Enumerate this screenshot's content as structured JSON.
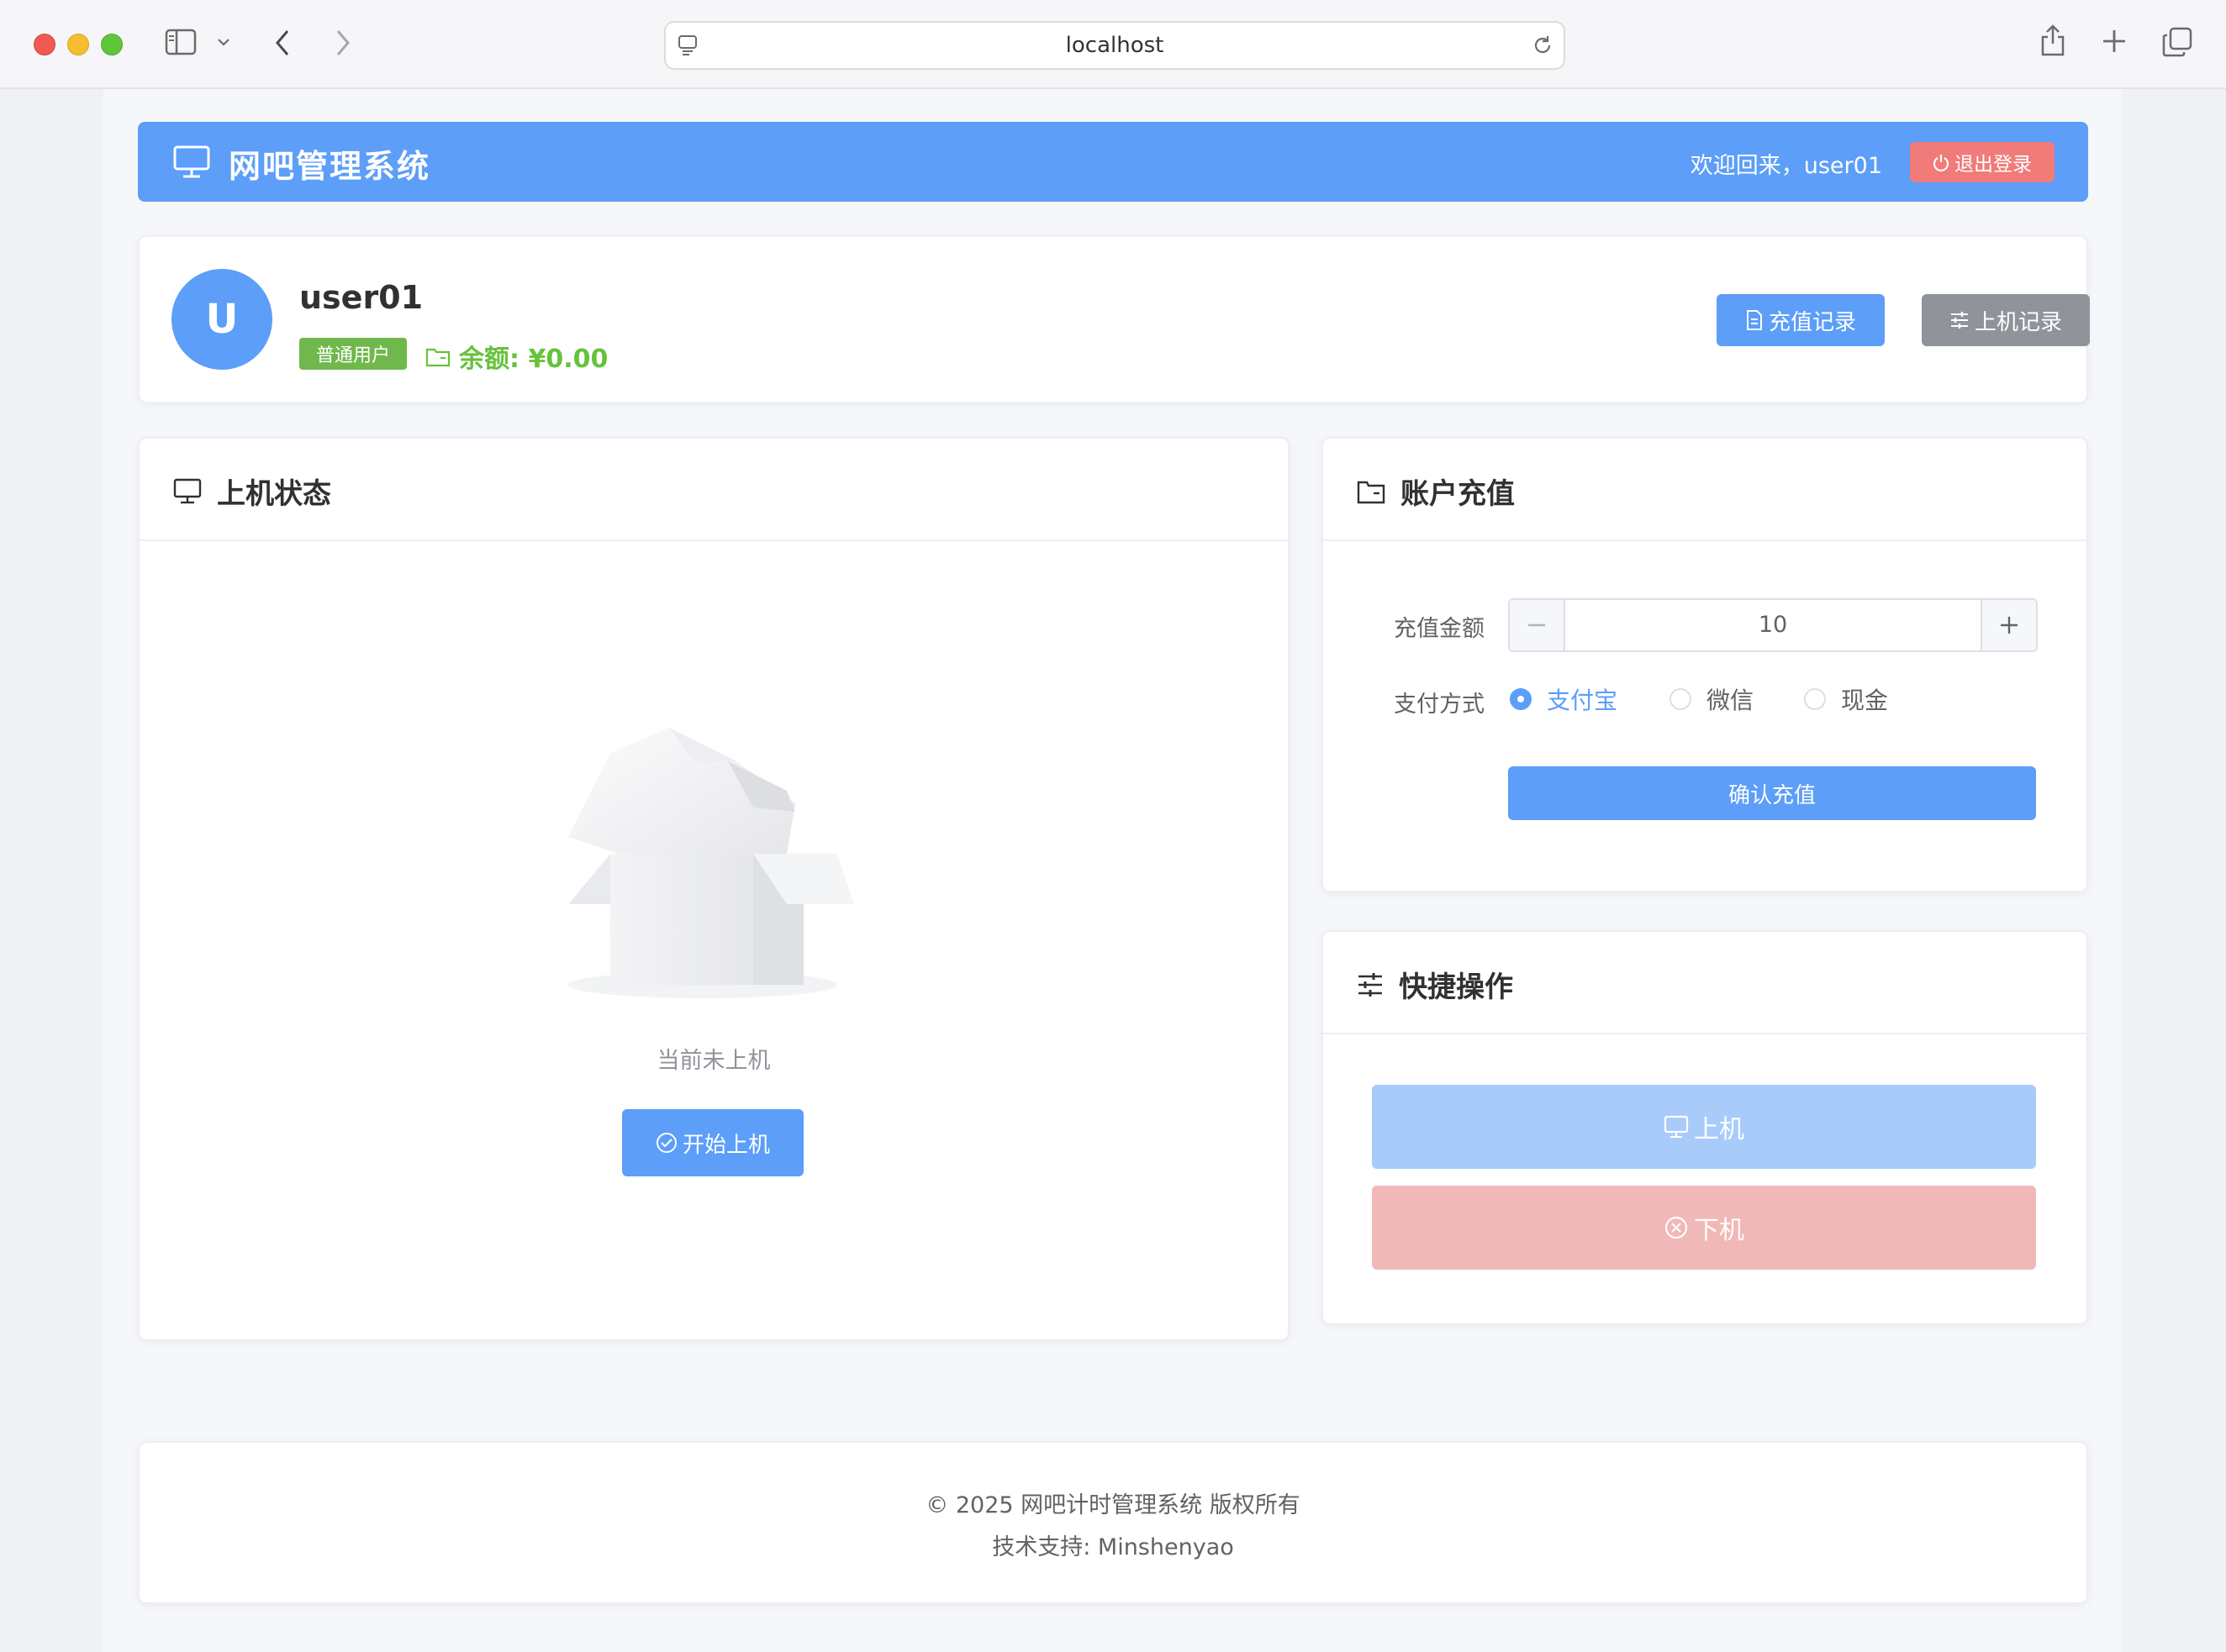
{
  "browser": {
    "url": "localhost"
  },
  "header": {
    "title": "网吧管理系统",
    "welcome": "欢迎回来，user01",
    "logout_label": "退出登录"
  },
  "user": {
    "avatar_letter": "U",
    "username": "user01",
    "role": "普通用户",
    "balance": "余额: ¥0.00",
    "recharge_records_label": "充值记录",
    "session_records_label": "上机记录"
  },
  "status_panel": {
    "title": "上机状态",
    "empty_text": "当前未上机",
    "start_label": "开始上机"
  },
  "recharge_panel": {
    "title": "账户充值",
    "amount_label": "充值金额",
    "amount_value": "10",
    "payment_label": "支付方式",
    "payment_options": [
      "支付宝",
      "微信",
      "现金"
    ],
    "selected_payment": "支付宝",
    "confirm_label": "确认充值"
  },
  "quick_panel": {
    "title": "快捷操作",
    "online_label": "上机",
    "offline_label": "下机"
  },
  "footer": {
    "copyright": "© 2025 网吧计时管理系统 版权所有",
    "support": "技术支持: Minshenyao"
  },
  "colors": {
    "primary": "#5c9ef8",
    "danger": "#f07b79",
    "success": "#67c23a",
    "info": "#909399"
  }
}
